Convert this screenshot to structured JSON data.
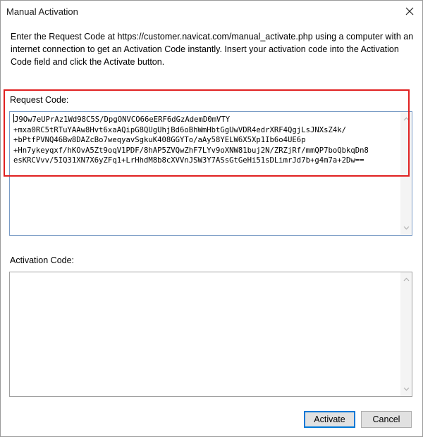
{
  "window": {
    "title": "Manual Activation",
    "close_glyph": "close-icon"
  },
  "instructions": "Enter the Request Code at https://customer.navicat.com/manual_activate.php using a computer with an internet connection to get an Activation Code instantly. Insert your activation code into the Activation Code field and click the Activate button.",
  "request": {
    "label": "Request Code:",
    "lines": [
      "J9Ow7eUPrAz1Wd98C5S/DpgONVCO66eERF6dGzAdemD0mVTY",
      "+mxa0RC5tRTuYAAw8Hvt6xaAQipG8QUgUhjBd6oBhWmHbtGgUwVDR4edrXRF4QgjLsJNXsZ4k/",
      "+bPtfPVNQ46Bw8DAZcBo7weqyavSgkuK408GGYTo/aAy58YELW6X5Xp1Ib6o4UE6p",
      "+Hn7ykeyqxf/hKOvA5Zt9oqV1PDF/8hAP5ZVQwZhF7LYv9oXNW81buj2N/ZRZjRf/mmQP7boQbkqDn8",
      "esKRCVvv/5IQ31XN7X6yZFq1+LrHhdM8b8cXVVnJSW3Y7ASsGtGeHi51sDLimrJd7b+g4m7a+2Dw=="
    ]
  },
  "activation": {
    "label": "Activation Code:",
    "value": ""
  },
  "buttons": {
    "activate": "Activate",
    "cancel": "Cancel"
  },
  "colors": {
    "highlight": "#e02020",
    "focus_border": "#0078d7"
  }
}
